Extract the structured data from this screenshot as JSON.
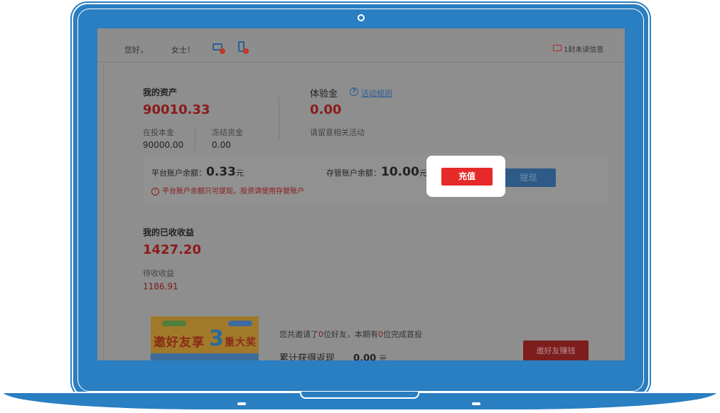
{
  "topbar": {
    "greeting": "您好，",
    "title": "女士！",
    "mail_text": "1封未读信息"
  },
  "assets": {
    "label": "我的资产",
    "total": "90010.33",
    "invested_label": "在投本金",
    "invested_value": "90000.00",
    "frozen_label": "冻结资金",
    "frozen_value": "0.00"
  },
  "trial": {
    "label": "体验金",
    "rules_link": "活动规则",
    "value": "0.00",
    "note": "请留意相关活动"
  },
  "balance": {
    "platform_label": "平台账户余额：",
    "platform_value": "0.33",
    "unit": "元",
    "custody_label": "存管账户余额：",
    "custody_value": "10.00",
    "warning": "平台账户余额只可提现，投资请使用存管账户"
  },
  "buttons": {
    "recharge": "充值",
    "withdraw": "提现",
    "invite": "邀好友赚钱"
  },
  "earnings": {
    "label": "我的已收收益",
    "total": "1427.20",
    "pending_label": "待收收益",
    "pending_value": "1186.91"
  },
  "invite": {
    "banner_text": "邀好友享",
    "banner_3": "3",
    "banner_tail": "重大奖",
    "line_prefix": "您共邀请了",
    "count_friends": "0",
    "line_mid": "位好友，本期有",
    "count_first": "0",
    "line_suffix": "位完成首投",
    "total_label": "累计获得返现",
    "total_value": "0.00",
    "total_unit": "元"
  },
  "colors": {
    "frame": "#2a7ec2",
    "recharge": "#e62a2a",
    "withdraw": "#2d5a86",
    "accent_red": "#8b1a1a"
  },
  "icons": [
    "bank-card-icon",
    "mobile-phone-icon",
    "mail-icon",
    "help-icon",
    "warning-icon",
    "camera-icon"
  ]
}
